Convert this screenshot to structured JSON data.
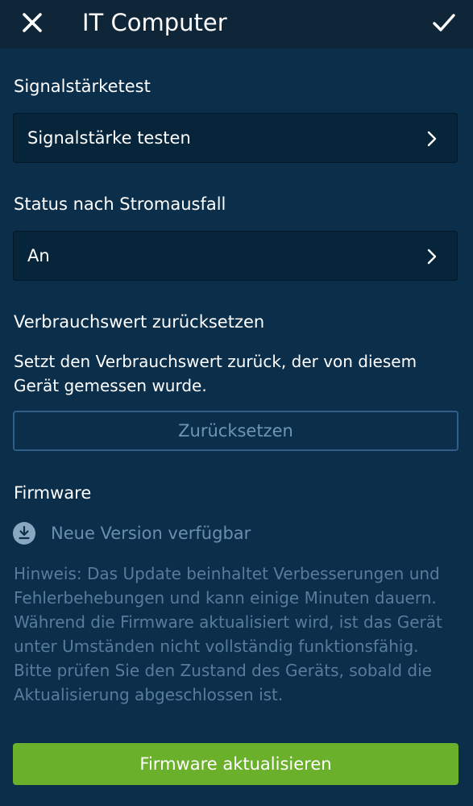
{
  "header": {
    "title": "IT Computer",
    "close_icon": "close-icon",
    "confirm_icon": "checkmark-icon"
  },
  "signal_test": {
    "title": "Signalstärketest",
    "row_label": "Signalstärke testen"
  },
  "power_status": {
    "title": "Status nach Stromausfall",
    "value": "An"
  },
  "consumption": {
    "title": "Verbrauchswert zurücksetzen",
    "description": "Setzt den Verbrauchswert zurück, der von diesem Gerät gemessen wurde.",
    "reset_label": "Zurücksetzen"
  },
  "firmware": {
    "title": "Firmware",
    "status_icon": "download-icon",
    "status_text": "Neue Version verfügbar",
    "hint": "Hinweis: Das Update beinhaltet Verbesserungen und Fehlerbehebungen und kann einige Minuten dauern. Während die Firmware aktualisiert wird, ist das Gerät unter Umständen nicht vollständig funktionsfähig. Bitte prüfen Sie den Zustand des Geräts, sobald die Aktualisierung abgeschlossen ist.",
    "update_label": "Firmware aktualisieren"
  },
  "colors": {
    "background": "#0b2e4a",
    "header": "#0f2538",
    "row_background": "#06243a",
    "accent_green": "#6ab02a",
    "muted_text": "#587c9b"
  }
}
